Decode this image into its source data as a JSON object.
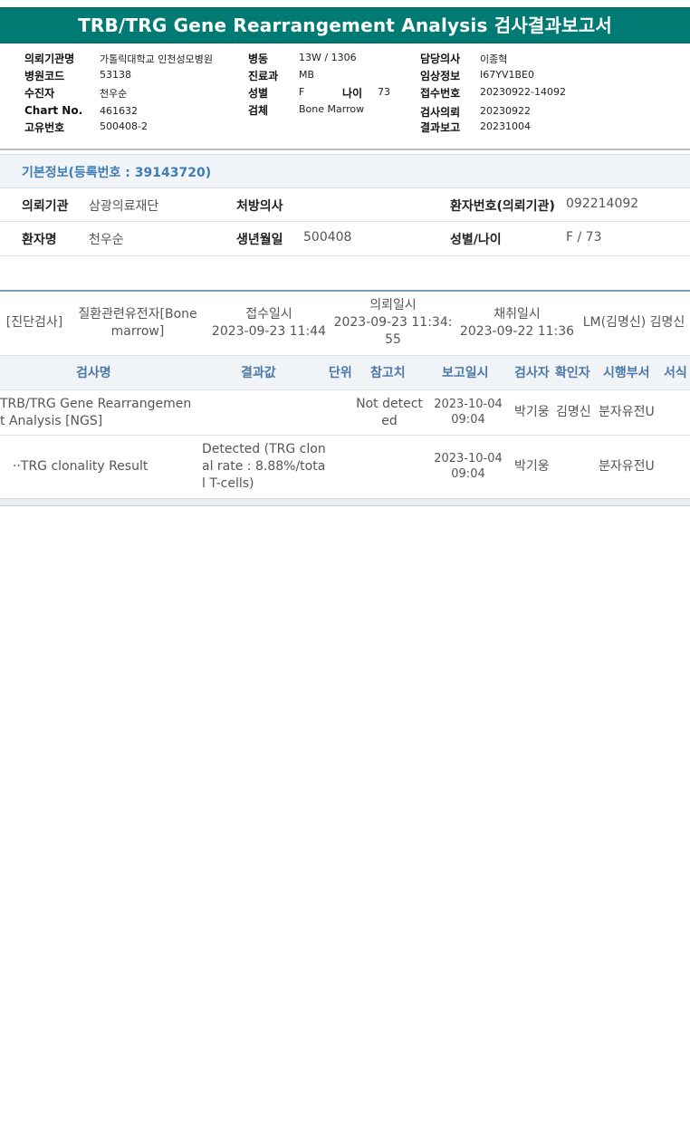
{
  "report": {
    "title": "TRB/TRG Gene Rearrangement Analysis 검사결과보고서",
    "labels": {
      "institution": "의뢰기관명",
      "hospital_code": "병원코드",
      "examinee": "수진자",
      "chart_no": "Chart No.",
      "unique_no": "고유번호",
      "ward": "병동",
      "department": "진료과",
      "sex": "성별",
      "age": "나이",
      "specimen": "검체",
      "physician": "담당의사",
      "clinical_info": "임상정보",
      "receipt_no": "접수번호",
      "request_date": "검사의뢰",
      "report_date": "결과보고"
    },
    "values": {
      "institution": "가톨릭대학교 인천성모병원",
      "hospital_code": "53138",
      "examinee": "천우순",
      "chart_no": "461632",
      "unique_no": "500408-2",
      "ward": "13W / 1306",
      "department": "MB",
      "sex": "F",
      "age": "73",
      "specimen": "Bone Marrow",
      "physician": "이종혁",
      "clinical_info": "I67YV1BE0",
      "receipt_no": "20230922-14092",
      "request_date": "20230922",
      "report_date": "20231004"
    }
  },
  "basic_info": {
    "title": "기본정보(등록번호 : 39143720)",
    "row1": {
      "institution_label": "의뢰기관",
      "institution_value": "삼광의료재단",
      "doctor_label": "처방의사",
      "doctor_value": "",
      "patient_no_label": "환자번호(의뢰기관)",
      "patient_no_value": "092214092"
    },
    "row2": {
      "name_label": "환자명",
      "name_value": "천우순",
      "birth_label": "생년월일",
      "birth_value": "500408",
      "sexage_label": "성별/나이",
      "sexage_value": "F / 73"
    }
  },
  "order": {
    "category": "[진단검사]",
    "test_l1": "질환관련유전자[Bone",
    "test_l2": "marrow]",
    "received_label": "접수일시",
    "received_value": "2023-09-23 11:44",
    "requested_label": "의뢰일시",
    "requested_l1": "2023-09-23 11:34:",
    "requested_l2": "55",
    "collected_label": "채취일시",
    "collected_value": "2023-09-22 11:36",
    "staff": "LM(김명신) 김명신"
  },
  "results": {
    "headers": [
      "검사명",
      "결과값",
      "단위",
      "참고치",
      "보고일시",
      "검사자",
      "확인자",
      "시행부서",
      "서식"
    ],
    "rows": [
      {
        "name_l1": "TRB/TRG Gene Rearrangemen",
        "name_l2": "t Analysis [NGS]",
        "result_l1": "",
        "result_l2": "",
        "result_l3": "",
        "unit": "",
        "ref_l1": "Not detect",
        "ref_l2": "ed",
        "date_l1": "2023-10-04",
        "date_l2": "09:04",
        "tester": "박기웅",
        "confirmer": "김명신",
        "department": "분자유전U"
      },
      {
        "name_l1": "··TRG clonality Result",
        "name_l2": "",
        "result_l1": "Detected (TRG clon",
        "result_l2": "al rate : 8.88%/tota",
        "result_l3": "l T-cells)",
        "unit": "",
        "ref_l1": "",
        "ref_l2": "",
        "date_l1": "2023-10-04",
        "date_l2": "09:04",
        "tester": "박기웅",
        "confirmer": "",
        "department": "분자유전U"
      }
    ]
  }
}
